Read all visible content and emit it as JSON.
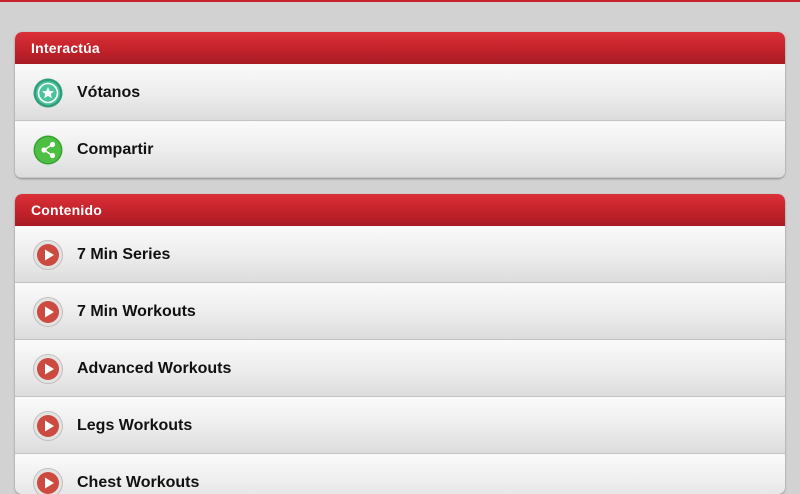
{
  "interact": {
    "title": "Interactúa",
    "items": [
      {
        "label": "Vótanos",
        "icon": "star-badge-icon"
      },
      {
        "label": "Compartir",
        "icon": "share-icon"
      }
    ]
  },
  "content": {
    "title": "Contenido",
    "items": [
      {
        "label": "7 Min Series",
        "icon": "play-icon"
      },
      {
        "label": "7 Min Workouts",
        "icon": "play-icon"
      },
      {
        "label": "Advanced Workouts",
        "icon": "play-icon"
      },
      {
        "label": "Legs Workouts",
        "icon": "play-icon"
      },
      {
        "label": "Chest Workouts",
        "icon": "play-icon"
      }
    ]
  },
  "colors": {
    "accent_red": "#c8232c",
    "vote_green": "#3bb38a",
    "share_green": "#43b83a",
    "play_red": "#c9473f"
  }
}
